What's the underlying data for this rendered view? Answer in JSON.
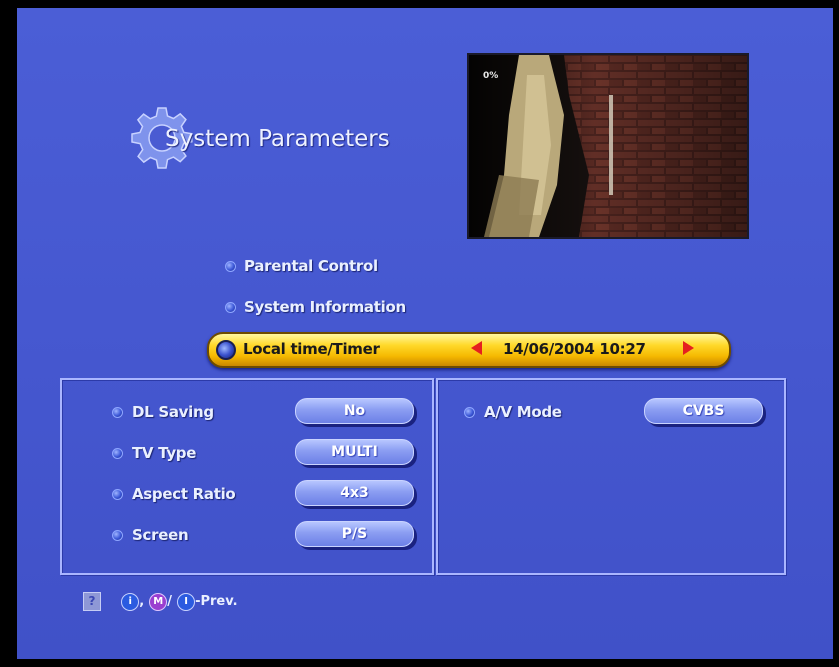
{
  "title": "System Parameters",
  "preview": {
    "osd_text": "0%"
  },
  "menu": {
    "items": [
      {
        "label": "Parental Control"
      },
      {
        "label": "System Information"
      }
    ],
    "selected": {
      "label": "Local time/Timer",
      "value": "14/06/2004 10:27"
    }
  },
  "left_panel": {
    "rows": [
      {
        "label": "DL Saving",
        "value": "No"
      },
      {
        "label": "TV Type",
        "value": "MULTI"
      },
      {
        "label": "Aspect Ratio",
        "value": "4x3"
      },
      {
        "label": "Screen",
        "value": "P/S"
      }
    ]
  },
  "right_panel": {
    "rows": [
      {
        "label": "A/V Mode",
        "value": "CVBS"
      }
    ]
  },
  "footer": {
    "help_glyph": "?",
    "info_glyph": "i",
    "menu_glyph": "M",
    "exit_glyph": "I",
    "separator_1": ",",
    "separator_2": "/",
    "text": "-Prev."
  },
  "colors": {
    "background": "#4557cf",
    "highlight": "#ffd92a",
    "arrow": "#e5201f",
    "pill": "#8b9df2"
  },
  "icons": [
    "gear-icon",
    "help-icon",
    "info-icon",
    "menu-icon",
    "exit-icon",
    "arrow-left-icon",
    "arrow-right-icon"
  ]
}
